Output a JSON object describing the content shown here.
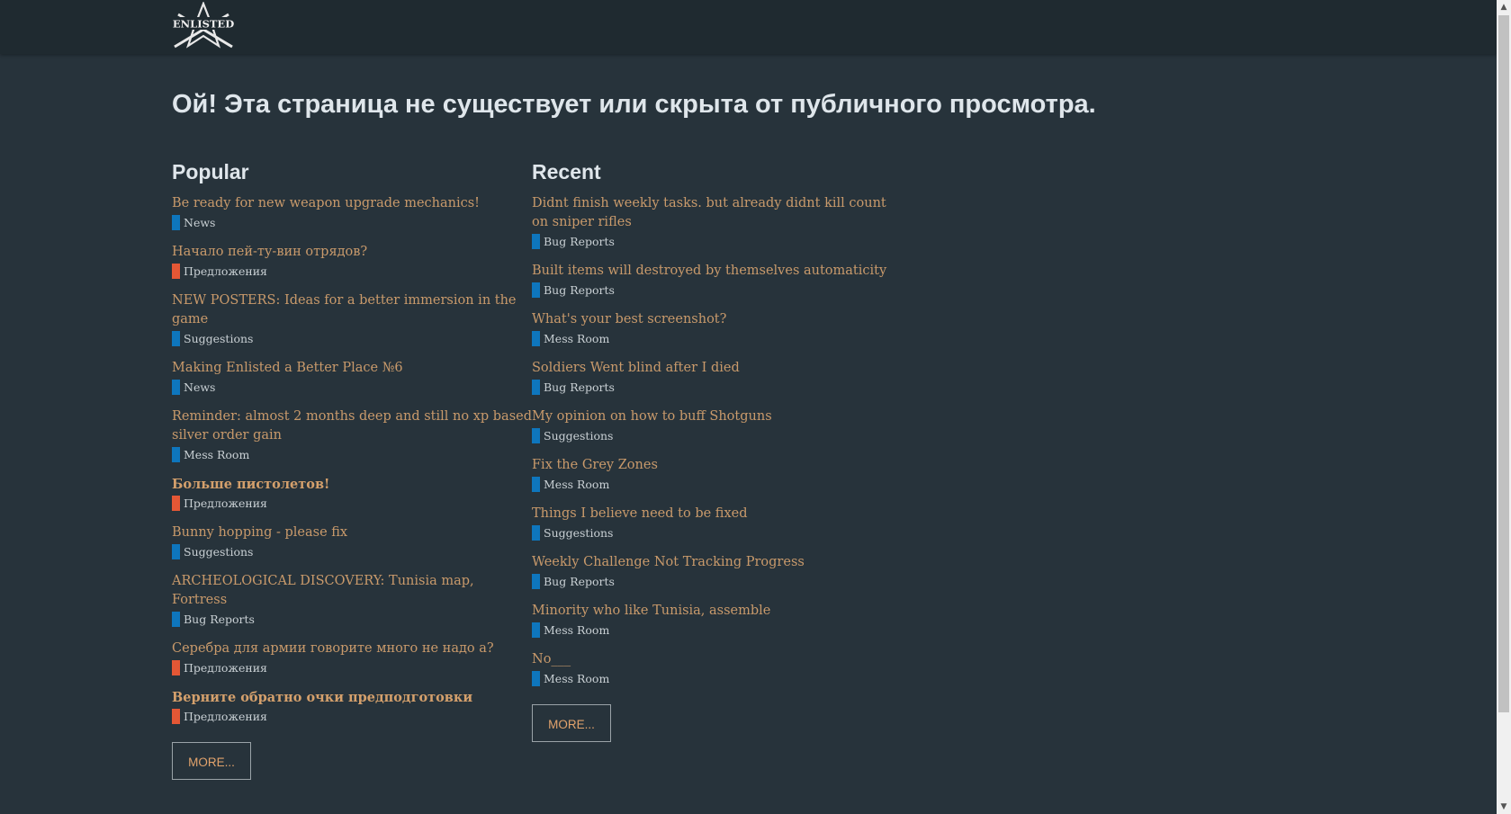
{
  "header": {
    "logo_text": "ENLISTED"
  },
  "page_title": "Ой! Эта страница не существует или скрыта от публичного просмотра.",
  "category_colors": {
    "News": "#0e76bd",
    "Предложения": "#e45735",
    "Suggestions": "#0e76bd",
    "Mess Room": "#0e76bd",
    "Bug Reports": "#0e76bd"
  },
  "popular": {
    "title": "Popular",
    "more_label": "MORE...",
    "topics": [
      {
        "title": "Be ready for new weapon upgrade mechanics!",
        "category": "News",
        "color": "#0e76bd",
        "bold": false
      },
      {
        "title": "Начало пей-ту-вин отрядов?",
        "category": "Предложения",
        "color": "#e45735",
        "bold": false
      },
      {
        "title": "NEW POSTERS: Ideas for a better immersion in the game",
        "category": "Suggestions",
        "color": "#0e76bd",
        "bold": false
      },
      {
        "title": "Making Enlisted a Better Place №6",
        "category": "News",
        "color": "#0e76bd",
        "bold": false
      },
      {
        "title": "Reminder: almost 2 months deep and still no xp based silver order gain",
        "category": "Mess Room",
        "color": "#0e76bd",
        "bold": false
      },
      {
        "title": "Больше пистолетов!",
        "category": "Предложения",
        "color": "#e45735",
        "bold": true
      },
      {
        "title": "Bunny hopping - please fix",
        "category": "Suggestions",
        "color": "#0e76bd",
        "bold": false
      },
      {
        "title": "ARCHEOLOGICAL DISCOVERY: Tunisia map, Fortress",
        "category": "Bug Reports",
        "color": "#0e76bd",
        "bold": false
      },
      {
        "title": "Серебра для армии говорите много не надо а?",
        "category": "Предложения",
        "color": "#e45735",
        "bold": false
      },
      {
        "title": "Верните обратно очки предподготовки",
        "category": "Предложения",
        "color": "#e45735",
        "bold": true
      }
    ]
  },
  "recent": {
    "title": "Recent",
    "more_label": "MORE...",
    "topics": [
      {
        "title": "Didnt finish weekly tasks. but already didnt kill count on sniper rifles",
        "category": "Bug Reports",
        "color": "#0e76bd",
        "bold": false
      },
      {
        "title": "Built items will destroyed by themselves automaticity",
        "category": "Bug Reports",
        "color": "#0e76bd",
        "bold": false
      },
      {
        "title": "What's your best screenshot?",
        "category": "Mess Room",
        "color": "#0e76bd",
        "bold": false
      },
      {
        "title": "Soldiers Went blind after I died",
        "category": "Bug Reports",
        "color": "#0e76bd",
        "bold": false
      },
      {
        "title": "My opinion on how to buff Shotguns",
        "category": "Suggestions",
        "color": "#0e76bd",
        "bold": false
      },
      {
        "title": "Fix the Grey Zones",
        "category": "Mess Room",
        "color": "#0e76bd",
        "bold": false
      },
      {
        "title": "Things I believe need to be fixed",
        "category": "Suggestions",
        "color": "#0e76bd",
        "bold": false
      },
      {
        "title": "Weekly Challenge Not Tracking Progress",
        "category": "Bug Reports",
        "color": "#0e76bd",
        "bold": false
      },
      {
        "title": "Minority who like Tunisia, assemble",
        "category": "Mess Room",
        "color": "#0e76bd",
        "bold": false
      },
      {
        "title": "No___",
        "category": "Mess Room",
        "color": "#0e76bd",
        "bold": false
      }
    ]
  }
}
